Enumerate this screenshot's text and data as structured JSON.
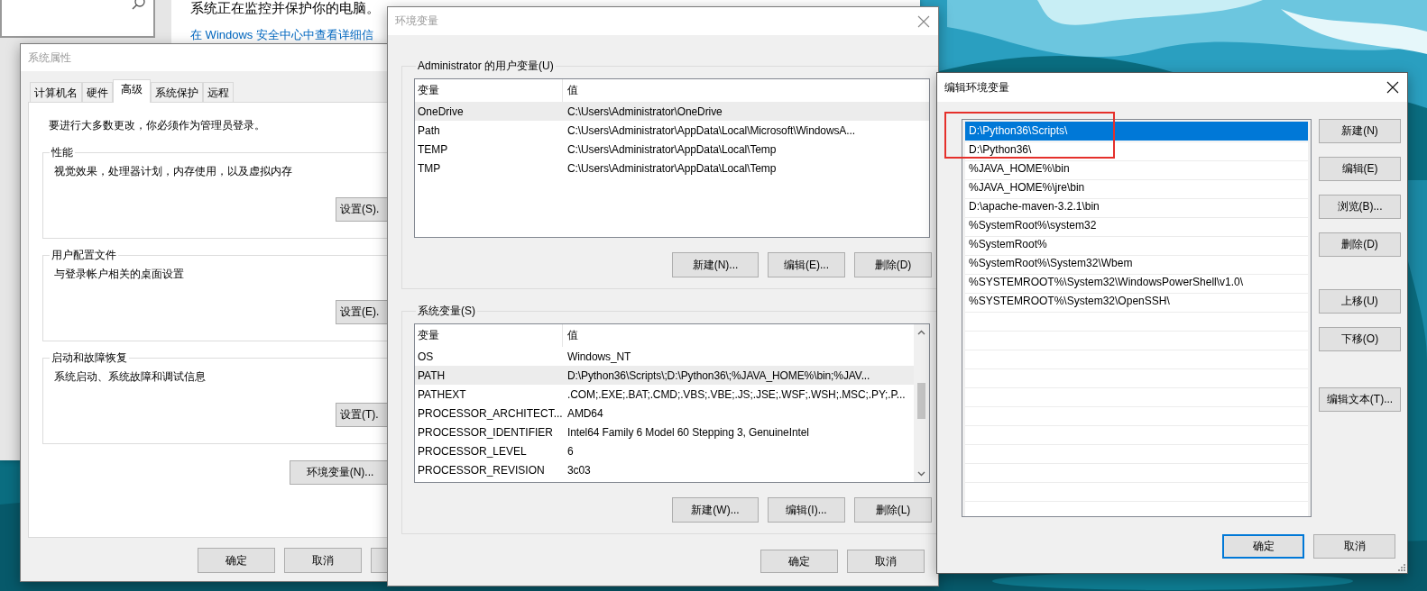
{
  "background_window": {
    "heading": "系统正在监控并保护你的电脑。",
    "link": "在 Windows 安全中心中查看详细信"
  },
  "system_properties": {
    "title": "系统属性",
    "tabs": [
      {
        "label": "计算机名",
        "selected": false
      },
      {
        "label": "硬件",
        "selected": false
      },
      {
        "label": "高级",
        "selected": true
      },
      {
        "label": "系统保护",
        "selected": false
      },
      {
        "label": "远程",
        "selected": false
      }
    ],
    "admin_note": "要进行大多数更改，你必须作为管理员登录。",
    "groups": [
      {
        "title": "性能",
        "description": "视觉效果，处理器计划，内存使用，以及虚拟内存",
        "button": "设置(S)."
      },
      {
        "title": "用户配置文件",
        "description": "与登录帐户相关的桌面设置",
        "button": "设置(E)."
      },
      {
        "title": "启动和故障恢复",
        "description": "系统启动、系统故障和调试信息",
        "button": "设置(T)."
      }
    ],
    "env_button": "环境变量(N)...",
    "buttons": [
      "确定",
      "取消"
    ]
  },
  "environment_variables": {
    "title": "环境变量",
    "user_vars": {
      "title": "Administrator 的用户变量(U)",
      "columns": [
        "变量",
        "值"
      ],
      "rows": [
        {
          "name": "OneDrive",
          "value": "C:\\Users\\Administrator\\OneDrive",
          "selected": true
        },
        {
          "name": "Path",
          "value": "C:\\Users\\Administrator\\AppData\\Local\\Microsoft\\WindowsA...",
          "selected": false
        },
        {
          "name": "TEMP",
          "value": "C:\\Users\\Administrator\\AppData\\Local\\Temp",
          "selected": false
        },
        {
          "name": "TMP",
          "value": "C:\\Users\\Administrator\\AppData\\Local\\Temp",
          "selected": false
        }
      ],
      "buttons": [
        "新建(N)...",
        "编辑(E)...",
        "删除(D)"
      ]
    },
    "system_vars": {
      "title": "系统变量(S)",
      "columns": [
        "变量",
        "值"
      ],
      "rows": [
        {
          "name": "OS",
          "value": "Windows_NT",
          "selected": false
        },
        {
          "name": "PATH",
          "value": "D:\\Python36\\Scripts\\;D:\\Python36\\;%JAVA_HOME%\\bin;%JAV...",
          "selected": true
        },
        {
          "name": "PATHEXT",
          "value": ".COM;.EXE;.BAT;.CMD;.VBS;.VBE;.JS;.JSE;.WSF;.WSH;.MSC;.PY;.P...",
          "selected": false
        },
        {
          "name": "PROCESSOR_ARCHITECT...",
          "value": "AMD64",
          "selected": false
        },
        {
          "name": "PROCESSOR_IDENTIFIER",
          "value": "Intel64 Family 6 Model 60 Stepping 3, GenuineIntel",
          "selected": false
        },
        {
          "name": "PROCESSOR_LEVEL",
          "value": "6",
          "selected": false
        },
        {
          "name": "PROCESSOR_REVISION",
          "value": "3c03",
          "selected": false
        }
      ],
      "buttons": [
        "新建(W)...",
        "编辑(I)...",
        "删除(L)"
      ]
    },
    "buttons": [
      "确定",
      "取消"
    ]
  },
  "edit_environment_variable": {
    "title": "编辑环境变量",
    "entries": [
      {
        "text": "D:\\Python36\\Scripts\\",
        "selected": true
      },
      {
        "text": "D:\\Python36\\",
        "selected": false
      },
      {
        "text": "%JAVA_HOME%\\bin",
        "selected": false
      },
      {
        "text": "%JAVA_HOME%\\jre\\bin",
        "selected": false
      },
      {
        "text": "D:\\apache-maven-3.2.1\\bin",
        "selected": false
      },
      {
        "text": "%SystemRoot%\\system32",
        "selected": false
      },
      {
        "text": "%SystemRoot%",
        "selected": false
      },
      {
        "text": "%SystemRoot%\\System32\\Wbem",
        "selected": false
      },
      {
        "text": "%SYSTEMROOT%\\System32\\WindowsPowerShell\\v1.0\\",
        "selected": false
      },
      {
        "text": "%SYSTEMROOT%\\System32\\OpenSSH\\",
        "selected": false
      }
    ],
    "side_button_groups": [
      [
        "新建(N)",
        "编辑(E)",
        "浏览(B)...",
        "删除(D)"
      ],
      [
        "上移(U)",
        "下移(O)"
      ],
      [
        "编辑文本(T)..."
      ]
    ],
    "buttons": [
      {
        "label": "确定",
        "focused": true
      },
      {
        "label": "取消",
        "focused": false
      }
    ]
  }
}
